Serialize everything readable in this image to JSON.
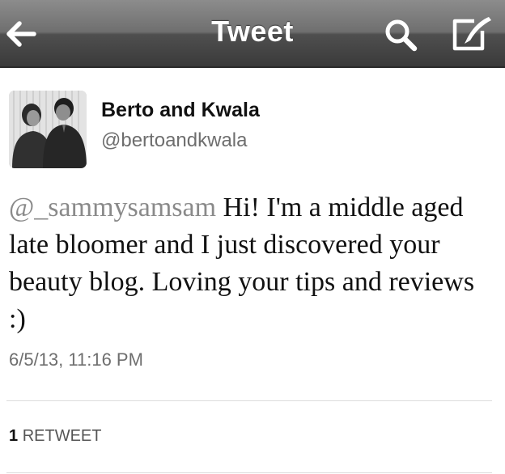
{
  "nav": {
    "title": "Tweet",
    "back_icon": "back-arrow-icon",
    "search_icon": "search-icon",
    "compose_icon": "compose-icon"
  },
  "author": {
    "name": "Berto and Kwala",
    "handle": "@bertoandkwala"
  },
  "tweet": {
    "mention": "@_sammysamsam",
    "body": " Hi!  I'm a middle aged late bloomer and I just discovered your beauty blog.  Loving your tips and reviews :)",
    "timestamp": "6/5/13, 11:16 PM"
  },
  "stats": {
    "retweet_count": "1",
    "retweet_label": "RETWEET"
  },
  "colors": {
    "nav_bar": "#5a5a5a",
    "mention": "#8a8a8a",
    "secondary_text": "#6e6e6e"
  }
}
